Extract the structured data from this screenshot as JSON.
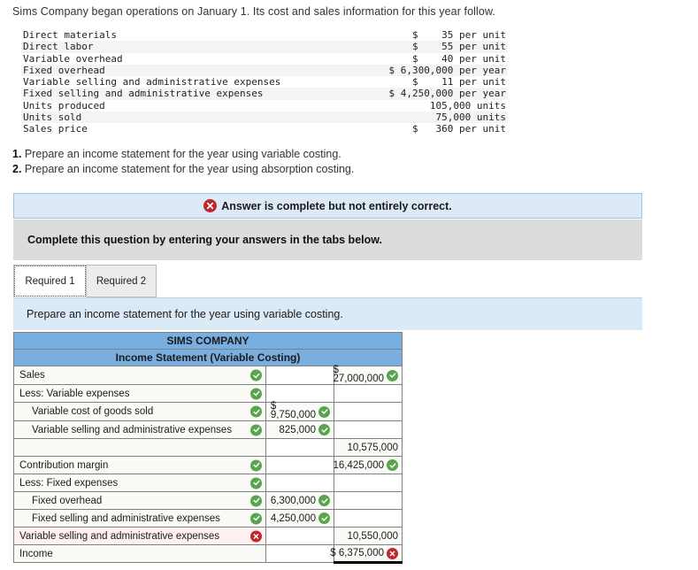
{
  "intro": "Sims Company began operations on January 1. Its cost and sales information for this year follow.",
  "facts": {
    "rows": [
      {
        "label": "Direct materials",
        "value": "$    35 per unit"
      },
      {
        "label": "Direct labor",
        "value": "$    55 per unit"
      },
      {
        "label": "Variable overhead",
        "value": "$    40 per unit"
      },
      {
        "label": "Fixed overhead",
        "value": "$ 6,300,000 per year"
      },
      {
        "label": "Variable selling and administrative expenses",
        "value": "$    11 per unit"
      },
      {
        "label": "Fixed selling and administrative expenses",
        "value": "$ 4,250,000 per year"
      },
      {
        "label": "Units produced",
        "value": "105,000 units"
      },
      {
        "label": "Units sold",
        "value": "75,000 units"
      },
      {
        "label": "Sales price",
        "value": "$   360 per unit"
      }
    ]
  },
  "requirements": [
    {
      "num": "1.",
      "text": "Prepare an income statement for the year using variable costing."
    },
    {
      "num": "2.",
      "text": "Prepare an income statement for the year using absorption costing."
    }
  ],
  "banner": {
    "icon": "x-circle-icon",
    "text": "Answer is complete but not entirely correct.",
    "bg_color": "#ddeaf6",
    "border_color": "#9dc3e6",
    "icon_color": "#c0282d"
  },
  "instruction_bar": {
    "text": "Complete this question by entering your answers in the tabs below.",
    "bg_color": "#dcdcdc"
  },
  "tabs": [
    {
      "label": "Required 1",
      "active": true
    },
    {
      "label": "Required 2",
      "active": false
    }
  ],
  "prompt": {
    "text": "Prepare an income statement for the year using variable costing.",
    "bg_color": "#dbeaf7"
  },
  "statement": {
    "header_bg": "#79aee0",
    "title": "SIMS COMPANY",
    "subtitle": "Income Statement (Variable Costing)",
    "ok_color": "#5aa44d",
    "error_color": "#c0282d",
    "rows": [
      {
        "label": "Sales",
        "indent": false,
        "label_mark": "ok",
        "row_error": false,
        "col1": "",
        "col1_dollar": false,
        "col1_mark": "",
        "col2": "27,000,000",
        "col2_dollar": true,
        "col2_mark": "ok",
        "total": false
      },
      {
        "label": "Less: Variable expenses",
        "indent": false,
        "label_mark": "ok",
        "row_error": false,
        "col1": "",
        "col1_dollar": false,
        "col1_mark": "",
        "col2": "",
        "col2_dollar": false,
        "col2_mark": "",
        "total": false
      },
      {
        "label": "Variable cost of goods sold",
        "indent": true,
        "label_mark": "ok",
        "row_error": false,
        "col1": "9,750,000",
        "col1_dollar": true,
        "col1_mark": "ok",
        "col2": "",
        "col2_dollar": false,
        "col2_mark": "",
        "total": false
      },
      {
        "label": "Variable selling and administrative expenses",
        "indent": true,
        "label_mark": "ok",
        "row_error": false,
        "col1": "825,000",
        "col1_dollar": false,
        "col1_mark": "ok",
        "col2": "",
        "col2_dollar": false,
        "col2_mark": "",
        "total": false
      },
      {
        "label": "",
        "indent": false,
        "label_mark": "",
        "row_error": false,
        "col1": "",
        "col1_dollar": false,
        "col1_mark": "",
        "col2": "10,575,000",
        "col2_dollar": false,
        "col2_mark": "",
        "total": false
      },
      {
        "label": "Contribution margin",
        "indent": false,
        "label_mark": "ok",
        "row_error": false,
        "col1": "",
        "col1_dollar": false,
        "col1_mark": "",
        "col2": "16,425,000",
        "col2_dollar": false,
        "col2_mark": "ok",
        "total": false
      },
      {
        "label": "Less: Fixed expenses",
        "indent": false,
        "label_mark": "ok",
        "row_error": false,
        "col1": "",
        "col1_dollar": false,
        "col1_mark": "",
        "col2": "",
        "col2_dollar": false,
        "col2_mark": "",
        "total": false
      },
      {
        "label": "Fixed overhead",
        "indent": true,
        "label_mark": "ok",
        "row_error": false,
        "col1": "6,300,000",
        "col1_dollar": false,
        "col1_mark": "ok",
        "col2": "",
        "col2_dollar": false,
        "col2_mark": "",
        "total": false
      },
      {
        "label": "Fixed selling and administrative expenses",
        "indent": true,
        "label_mark": "ok",
        "row_error": false,
        "col1": "4,250,000",
        "col1_dollar": false,
        "col1_mark": "ok",
        "col2": "",
        "col2_dollar": false,
        "col2_mark": "",
        "total": false
      },
      {
        "label": "Variable selling and administrative expenses",
        "indent": false,
        "label_mark": "bad",
        "row_error": true,
        "col1": "",
        "col1_dollar": false,
        "col1_mark": "",
        "col2": "10,550,000",
        "col2_dollar": false,
        "col2_mark": "",
        "total": false
      },
      {
        "label": "Income",
        "indent": false,
        "label_mark": "",
        "row_error": false,
        "col1": "",
        "col1_dollar": false,
        "col1_mark": "",
        "col2": "$ 6,375,000",
        "col2_dollar": false,
        "col2_mark": "bad",
        "total": true
      }
    ]
  }
}
